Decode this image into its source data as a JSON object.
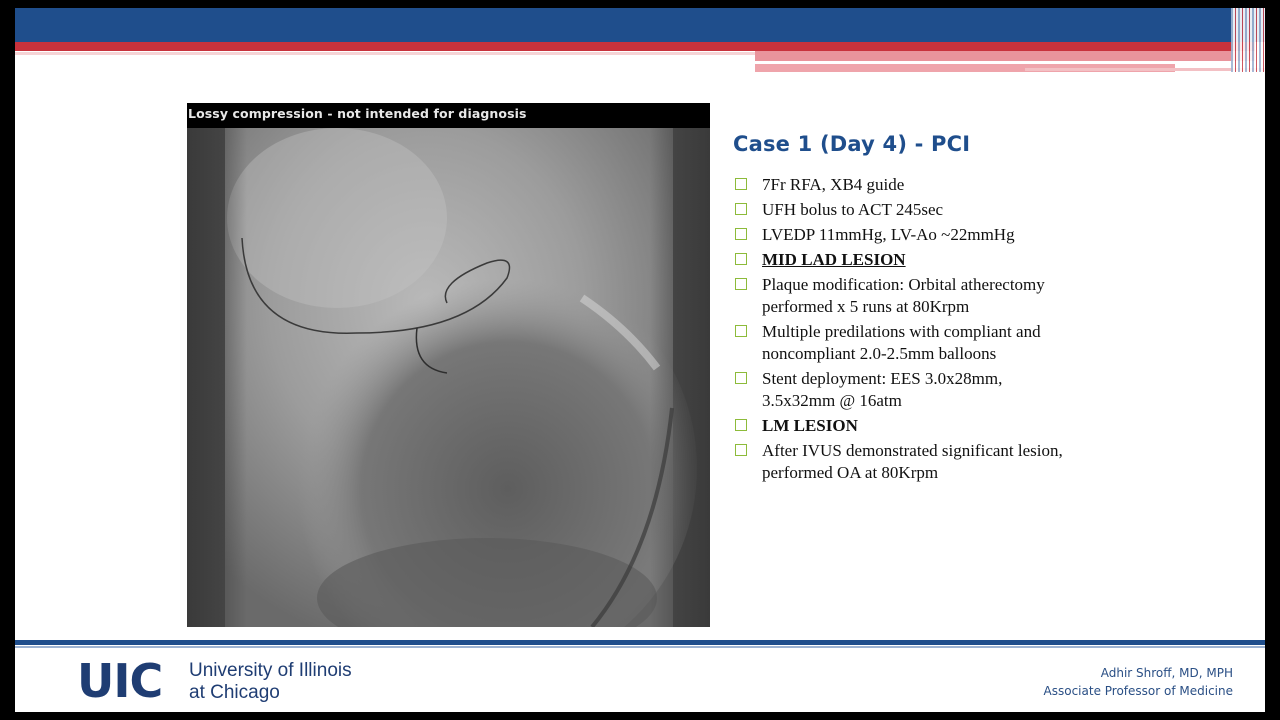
{
  "xray": {
    "overlay_label": "Lossy compression - not intended for diagnosis"
  },
  "slide": {
    "title": "Case 1 (Day 4) - PCI",
    "bullets": [
      {
        "text": "7Fr RFA, XB4 guide",
        "style": "normal"
      },
      {
        "text": "UFH bolus to ACT 245sec",
        "style": "normal"
      },
      {
        "text": "LVEDP 11mmHg, LV-Ao ~22mmHg",
        "style": "normal"
      },
      {
        "text": "MID LAD LESION",
        "style": "bold-underline"
      },
      {
        "text": "Plaque modification: Orbital atherectomy performed x 5 runs at 80Krpm",
        "style": "normal"
      },
      {
        "text": "Multiple predilations with compliant and noncompliant 2.0-2.5mm balloons",
        "style": "normal"
      },
      {
        "text": "Stent deployment: EES 3.0x28mm, 3.5x32mm @ 16atm",
        "style": "normal"
      },
      {
        "text": "LM LESION",
        "style": "bold"
      },
      {
        "text": "After IVUS demonstrated significant lesion, performed OA at 80Krpm",
        "style": "normal"
      }
    ],
    "bullet_icon": "checkbox-square-icon"
  },
  "footer": {
    "logo_text": "UIC",
    "institution_line1": "University of Illinois",
    "institution_line2": "at Chicago",
    "presenter_name": "Adhir Shroff, MD, MPH",
    "presenter_title": "Associate Professor of Medicine"
  },
  "colors": {
    "brand_blue": "#1f4e8c",
    "brand_red": "#c8323c",
    "bullet_green": "#8dbb3a"
  }
}
